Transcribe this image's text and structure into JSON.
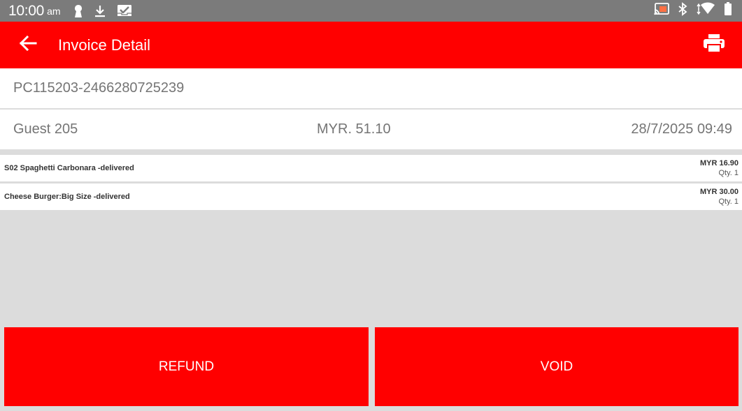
{
  "status_bar": {
    "time": "10:00",
    "ampm": "am",
    "left_icons": [
      "keyhole-icon",
      "download-icon",
      "inbox-check-icon"
    ],
    "right_icons": [
      "cast-icon",
      "bluetooth-icon",
      "wifi-icon",
      "battery-icon"
    ]
  },
  "app_bar": {
    "title": "Invoice Detail",
    "back_icon": "arrow-left-icon",
    "print_icon": "printer-icon"
  },
  "invoice": {
    "number": "PC115203-2466280725239",
    "guest": "Guest 205",
    "total": "MYR. 51.10",
    "datetime": "28/7/2025 09:49"
  },
  "items": [
    {
      "name": "S02 Spaghetti Carbonara  -delivered",
      "price": "MYR 16.90",
      "qty": "Qty. 1"
    },
    {
      "name": "Cheese Burger:Big Size  -delivered",
      "price": "MYR 30.00",
      "qty": "Qty. 1"
    }
  ],
  "actions": {
    "refund": "REFUND",
    "void": "VOID"
  },
  "colors": {
    "accent": "#ff0000",
    "status_bar": "#7b7b7b",
    "background": "#dcdcdc"
  }
}
